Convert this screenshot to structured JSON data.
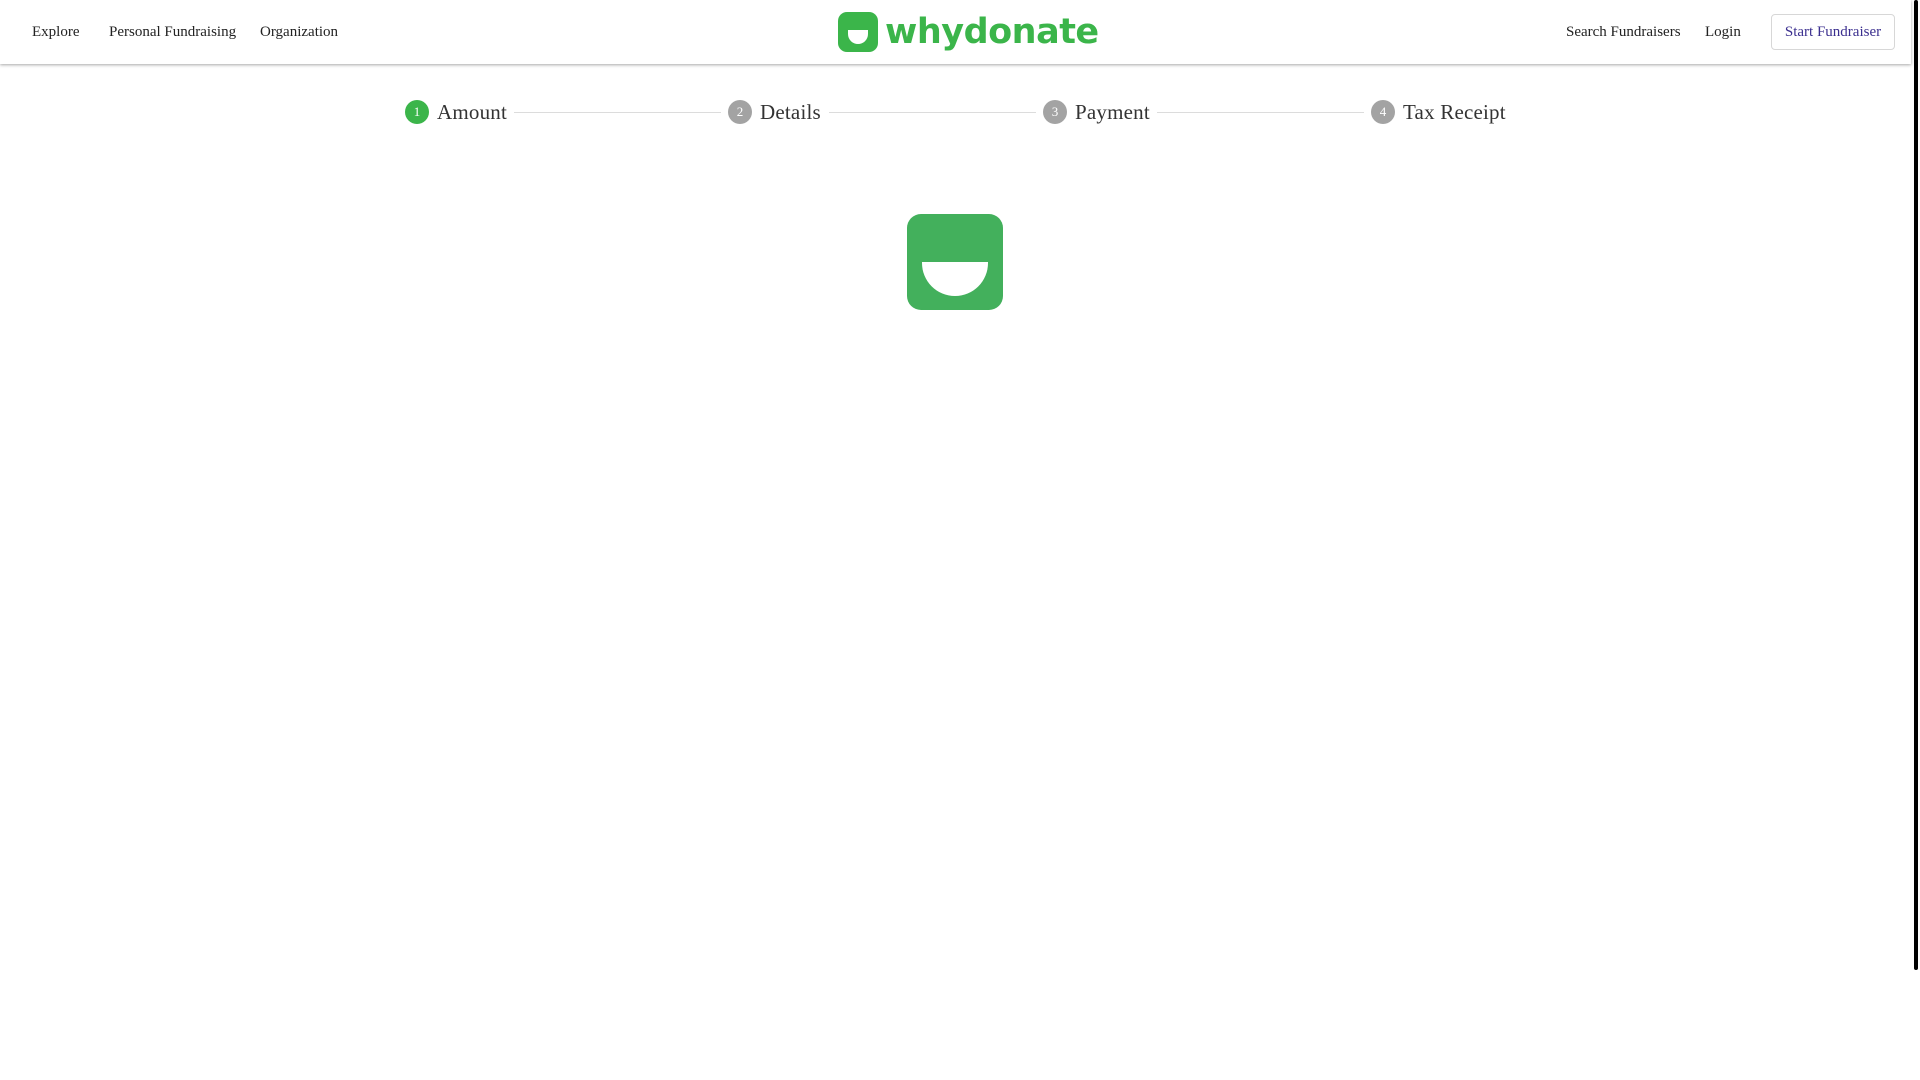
{
  "brand": {
    "name": "whydonate",
    "primary_color": "#3bb54a",
    "loader_color": "#43b05c",
    "link_color": "#3b2f8f"
  },
  "header": {
    "nav_left": [
      "Explore",
      "Personal Fundraising",
      "Organization"
    ],
    "nav_right": [
      "Search Fundraisers",
      "Login"
    ],
    "cta_label": "Start Fundraiser"
  },
  "stepper": {
    "active_step": 1,
    "active_color": "#3bb54a",
    "inactive_color": "#a3a3a3",
    "steps": [
      {
        "number": "1",
        "label": "Amount"
      },
      {
        "number": "2",
        "label": "Details"
      },
      {
        "number": "3",
        "label": "Payment"
      },
      {
        "number": "4",
        "label": "Tax Receipt"
      }
    ]
  },
  "loader": {
    "icon": "whydonate-logo-icon"
  }
}
